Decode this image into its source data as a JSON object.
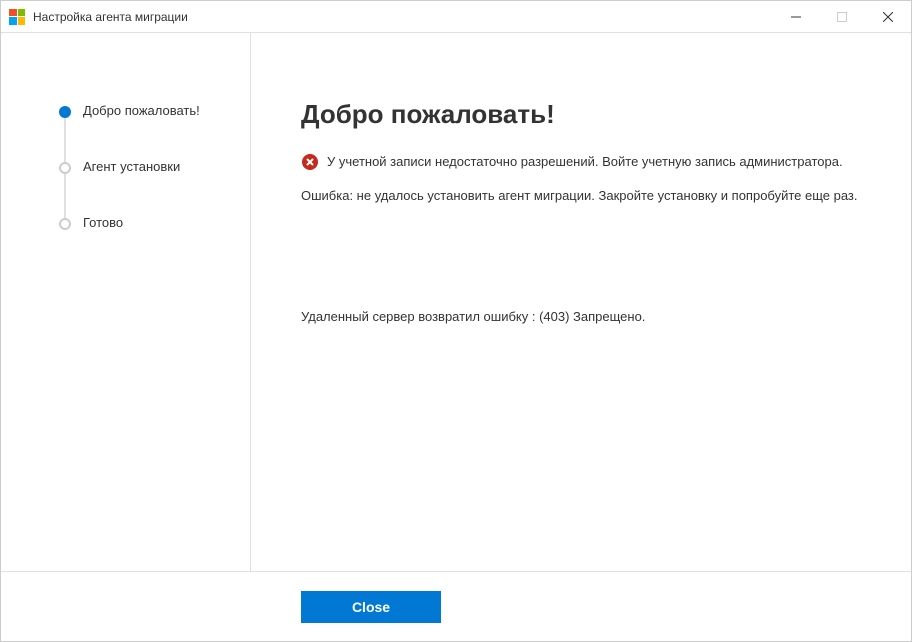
{
  "window": {
    "title": "Настройка агента миграции"
  },
  "sidebar": {
    "steps": [
      {
        "label": "Добро пожаловать!",
        "active": true
      },
      {
        "label": "Агент установки",
        "active": false
      },
      {
        "label": "Готово",
        "active": false
      }
    ]
  },
  "main": {
    "heading": "Добро пожаловать!",
    "error_message": "У учетной записи недостаточно разрешений. Войте учетную запись администратора.",
    "error_sub": "Ошибка: не удалось установить агент миграции. Закройте установку и попробуйте еще раз.",
    "error_detail": "Удаленный сервер возвратил ошибку : (403) Запрещено."
  },
  "footer": {
    "close_label": "Close"
  },
  "colors": {
    "accent": "#0078d4",
    "error": "#c42b1c"
  }
}
